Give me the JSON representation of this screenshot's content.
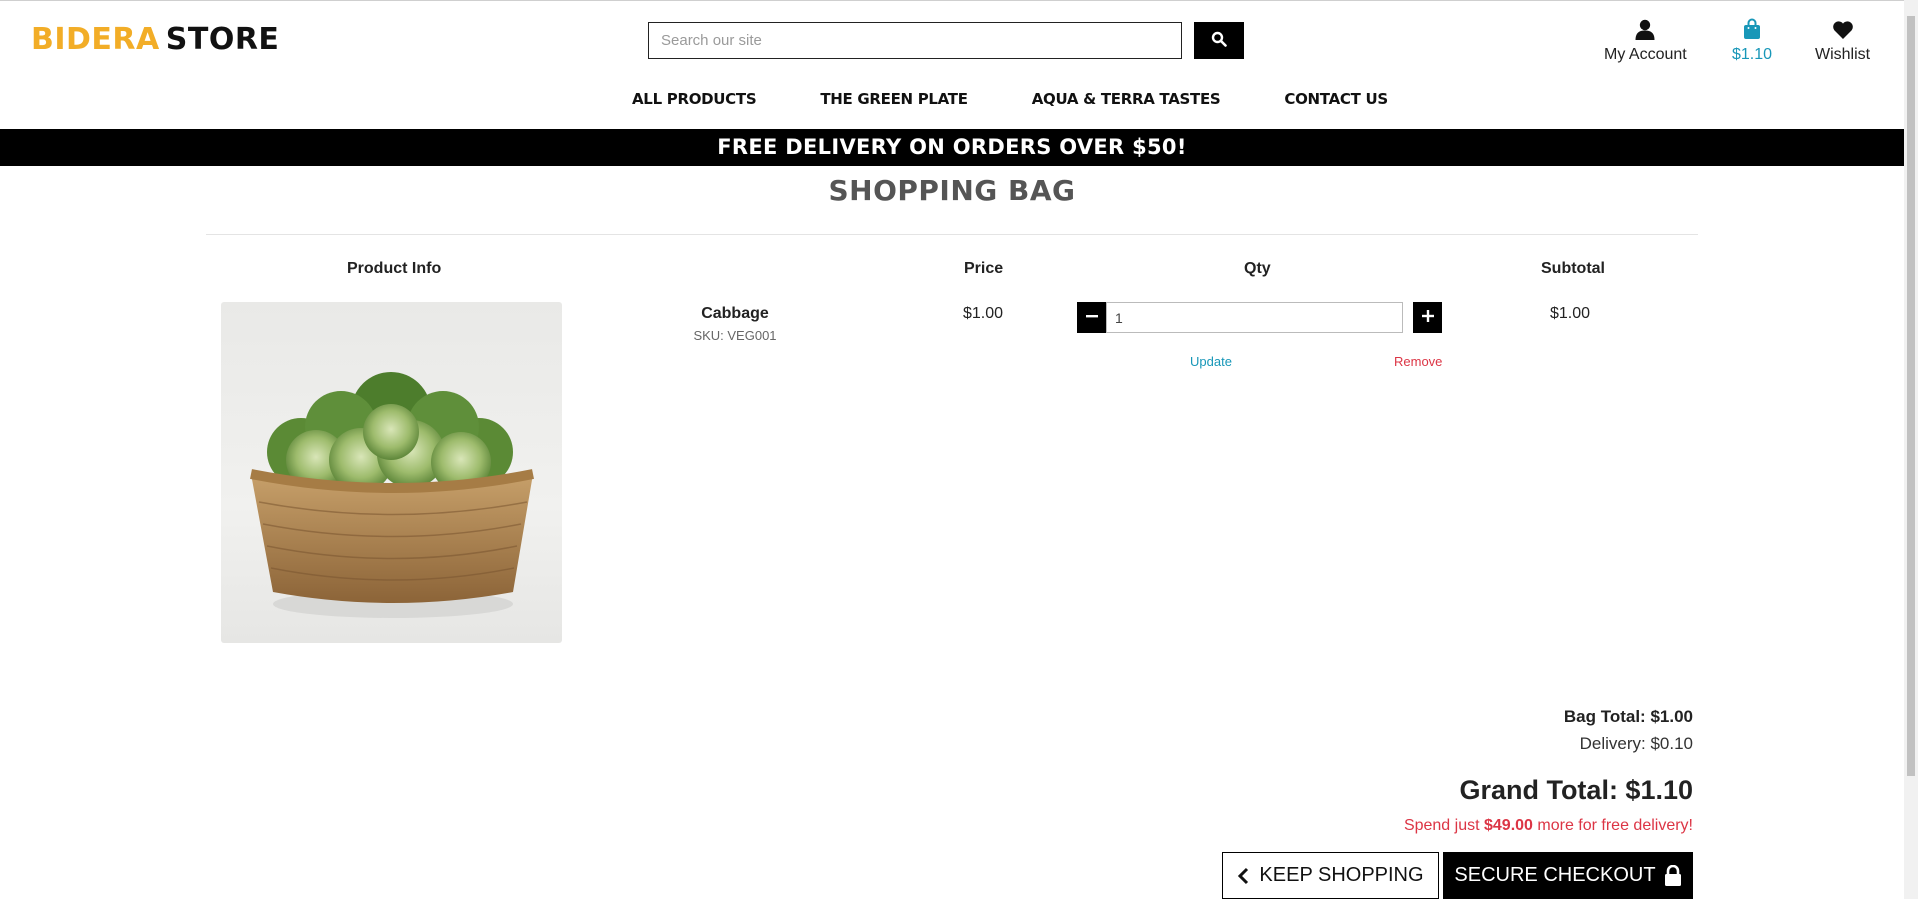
{
  "header": {
    "logo_brand": "BIDERA",
    "logo_store": "STORE",
    "search_placeholder": "Search our site",
    "account_label": "My Account",
    "bag_label": "$1.10",
    "wishlist_label": "Wishlist",
    "bag_color": "#1897b8",
    "brand_color": "#f2ad27"
  },
  "nav": {
    "items": [
      "ALL PRODUCTS",
      "THE GREEN PLATE",
      "AQUA & TERRA TASTES",
      "CONTACT US"
    ]
  },
  "promo": {
    "text": "FREE DELIVERY ON ORDERS OVER $50!"
  },
  "page": {
    "title": "SHOPPING BAG"
  },
  "table": {
    "headers": [
      "Product Info",
      "Price",
      "Qty",
      "Subtotal"
    ],
    "rows": [
      {
        "name": "Cabbage",
        "sku": "SKU: VEG001",
        "price": "$1.00",
        "qty": "1",
        "subtotal": "$1.00",
        "update_label": "Update",
        "remove_label": "Remove"
      }
    ]
  },
  "totals": {
    "bag_total": "Bag Total: $1.00",
    "delivery": "Delivery: $0.10",
    "grand_total": "Grand Total: $1.10",
    "spend_prefix": "Spend just ",
    "spend_amount": "$49.00",
    "spend_suffix": " more for free delivery!"
  },
  "buttons": {
    "keep_shopping": "KEEP SHOPPING",
    "secure_checkout": "SECURE CHECKOUT"
  },
  "icons": {
    "search": "search-icon",
    "account": "user-icon",
    "bag": "shopping-bag-icon",
    "wishlist": "heart-icon",
    "minus": "minus-icon",
    "plus": "plus-icon",
    "back": "chevron-left-icon",
    "lock": "lock-icon"
  }
}
